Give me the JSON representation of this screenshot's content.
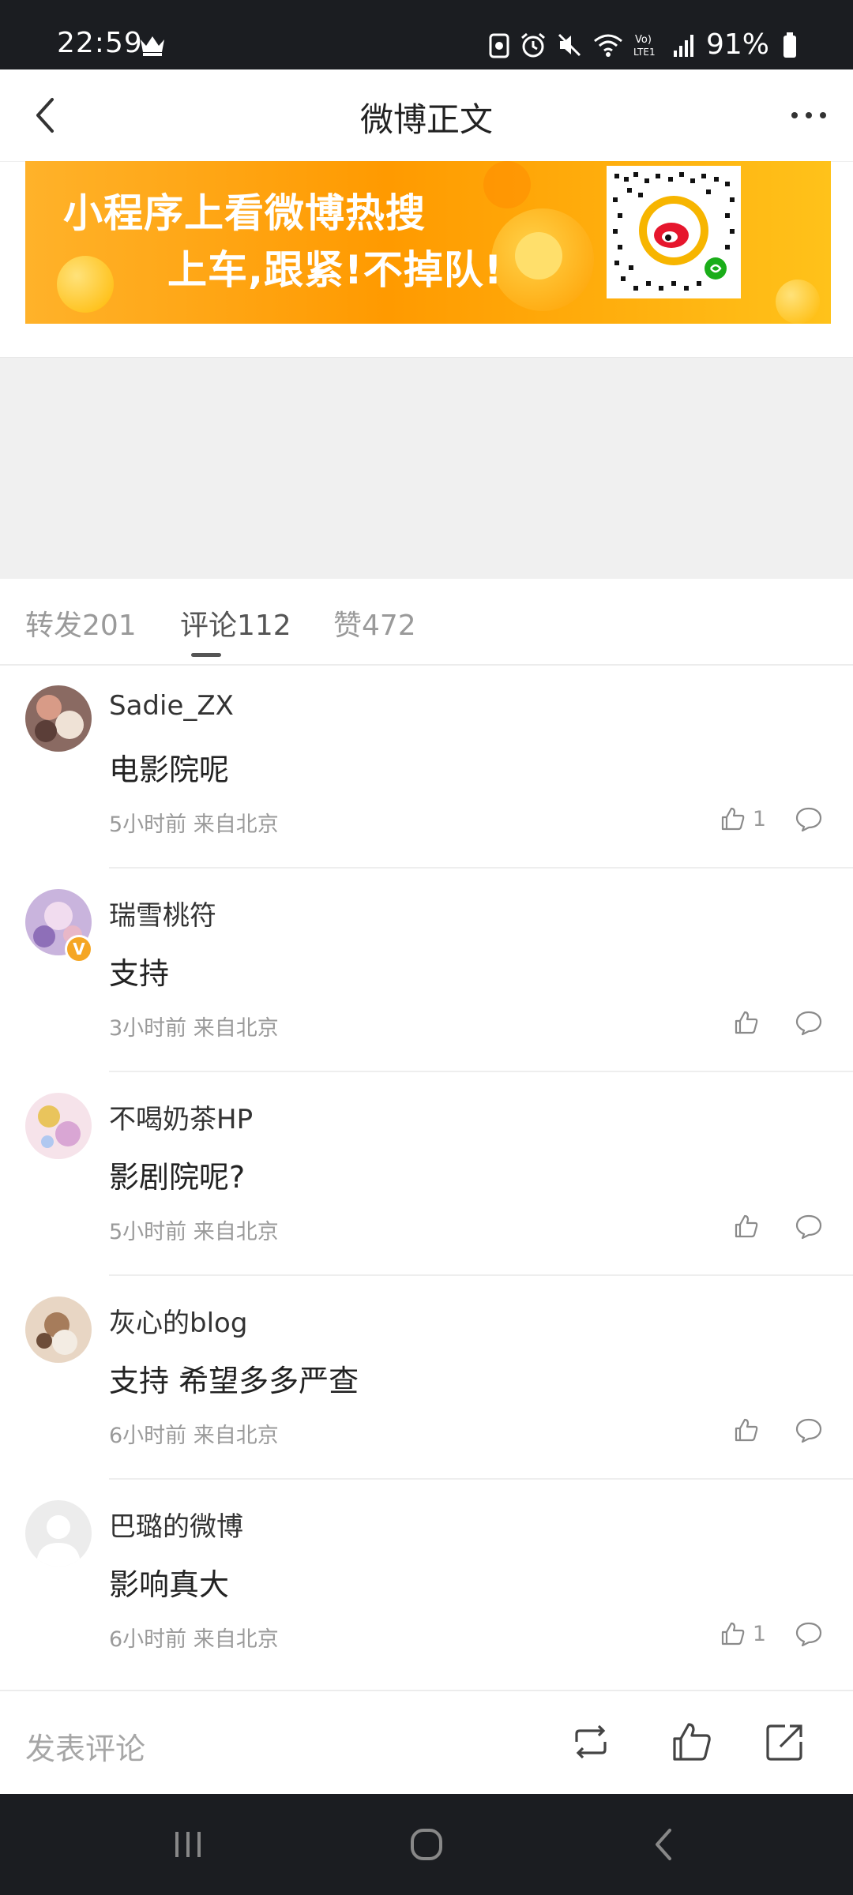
{
  "status_bar": {
    "time": "22:59",
    "battery": "91%",
    "icons": [
      "crown-icon",
      "assistant-icon",
      "alarm-icon",
      "mute-icon",
      "wifi-icon",
      "volte-icon",
      "signal-icon",
      "battery-icon"
    ]
  },
  "header": {
    "title": "微博正文",
    "back_icon": "chevron-left-icon",
    "more_icon": "more-dots-icon"
  },
  "banner": {
    "line1": "小程序上看微博热搜",
    "line2": "上车,跟紧!不掉队!",
    "qr_icon": "weibo-qr-code"
  },
  "tabs": [
    {
      "label": "转发201"
    },
    {
      "label": "评论112"
    },
    {
      "label": "赞472"
    }
  ],
  "comments": [
    {
      "user": "Sadie_ZX",
      "text": "电影院呢",
      "meta": "5小时前 来自北京",
      "likes": "1"
    },
    {
      "user": "瑞雪桃符",
      "text": "支持",
      "meta": "3小时前 来自北京",
      "likes": ""
    },
    {
      "user": "不喝奶茶HP",
      "text": "影剧院呢?",
      "meta": "5小时前 来自北京",
      "likes": ""
    },
    {
      "user": "灰心的blog",
      "text": "支持 希望多多严查",
      "meta": "6小时前 来自北京",
      "likes": ""
    },
    {
      "user": "巴璐的微博",
      "text": "影响真大",
      "meta": "6小时前 来自北京",
      "likes": "1"
    }
  ],
  "verified_badge": "V",
  "bottom_bar": {
    "input_placeholder": "发表评论",
    "icons": [
      "repost-icon",
      "like-icon",
      "share-icon"
    ]
  },
  "colors": {
    "banner_orange": "#ff9a00",
    "tab_active": "#555555",
    "meta_gray": "#9a9a9a",
    "verified_badge": "#f5a623"
  }
}
